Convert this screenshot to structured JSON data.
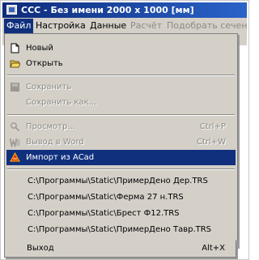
{
  "window": {
    "title": "ССС - Без имени   2000 x 1000 [мм]"
  },
  "menubar": {
    "items": [
      {
        "label": "Файл",
        "state": "active"
      },
      {
        "label": "Настройка",
        "state": "normal"
      },
      {
        "label": "Данные",
        "state": "normal"
      },
      {
        "label": "Расчёт",
        "state": "disabled"
      },
      {
        "label": "Подобрать сечен",
        "state": "disabled"
      }
    ]
  },
  "file_menu": {
    "new": {
      "label": "Новый",
      "icon": "new-document-icon",
      "enabled": true
    },
    "open": {
      "label": "Открыть",
      "icon": "open-folder-icon",
      "enabled": true
    },
    "save": {
      "label": "Сохранить",
      "icon": "save-disk-icon",
      "enabled": false
    },
    "save_as": {
      "label": "Сохранить как...",
      "enabled": false
    },
    "preview": {
      "label": "Просмотр...",
      "shortcut": "Ctrl+P",
      "icon": "print-preview-icon",
      "enabled": false
    },
    "export_word": {
      "label": "Вывод в Word",
      "shortcut": "Ctrl+W",
      "icon": "word-icon",
      "enabled": false
    },
    "import_acad": {
      "label": "Импорт из ACad",
      "icon": "acad-icon",
      "enabled": true,
      "highlighted": true
    },
    "recent_files": [
      "C:\\Программы\\Static\\ПримерДено Дер.TRS",
      "C:\\Программы\\Static\\Ферма 27 н.TRS",
      "C:\\Программы\\Static\\Брест Ф12.TRS",
      "C:\\Программы\\Static\\ПримерДено Тавр.TRS"
    ],
    "exit": {
      "label": "Выход",
      "shortcut": "Alt+X",
      "enabled": true
    }
  },
  "colors": {
    "title_bar_start": "#0d2b7a",
    "title_bar_end": "#2a63c9",
    "menu_bg": "#d4d0c8",
    "highlight": "#10307e",
    "disabled_text": "#8c8a86"
  }
}
